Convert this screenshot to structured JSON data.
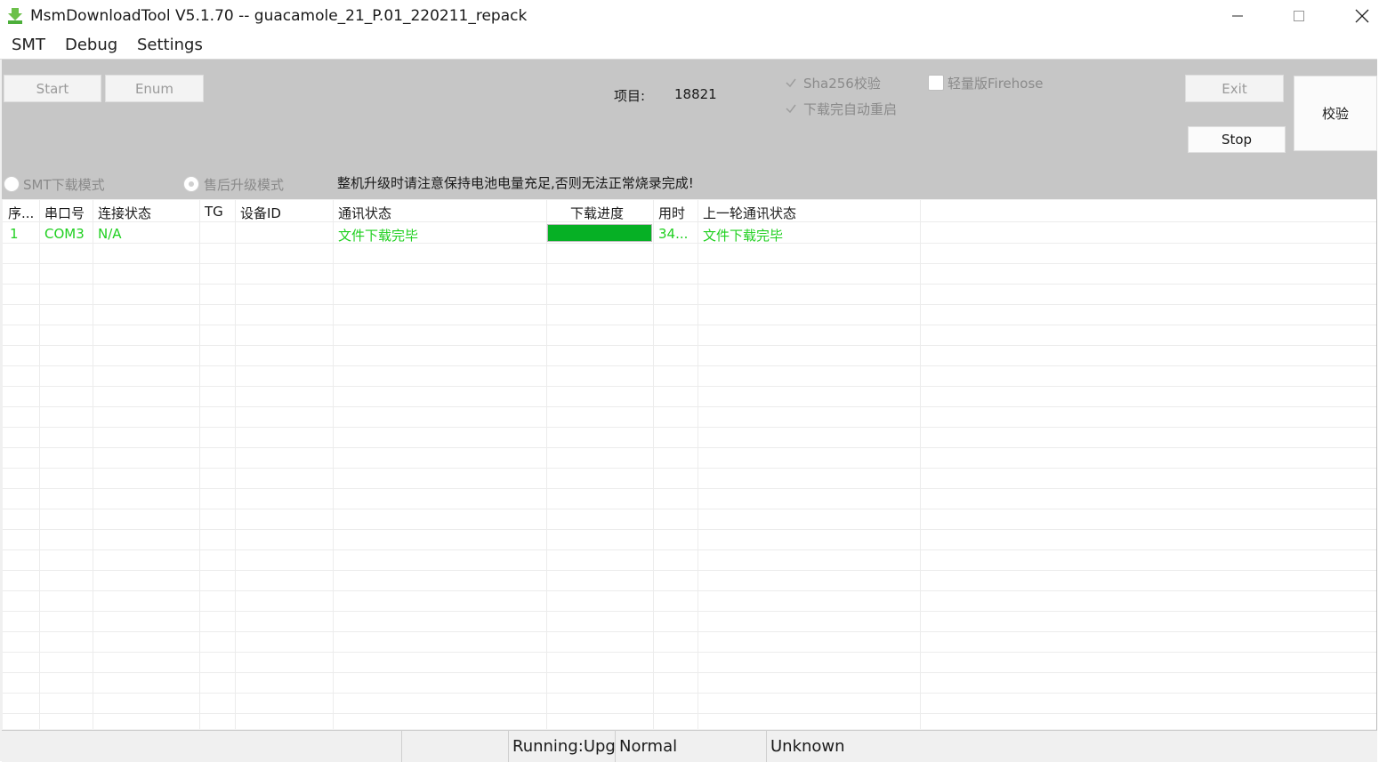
{
  "window": {
    "title": "MsmDownloadTool V5.1.70 -- guacamole_21_P.01_220211_repack"
  },
  "menu": [
    "SMT",
    "Debug",
    "Settings"
  ],
  "toolbar": {
    "start_label": "Start",
    "enum_label": "Enum",
    "project_label": "项目:",
    "project_value": "18821",
    "sha256_label": "Sha256校验",
    "sha256_checked": true,
    "autoreboot_label": "下载完自动重启",
    "autoreboot_checked": true,
    "lite_firehose_label": "轻量版Firehose",
    "lite_firehose_checked": false,
    "exit_label": "Exit",
    "stop_label": "Stop",
    "verify_label": "校验",
    "smt_mode_label": "SMT下载模式",
    "aftersale_mode_label": "售后升级模式",
    "warning": "整机升级时请注意保持电池电量充足,否则无法正常烧录完成!"
  },
  "table": {
    "headers": [
      "序...",
      "串口号",
      "连接状态",
      "TG",
      "设备ID",
      "通讯状态",
      "下载进度",
      "用时",
      "上一轮通讯状态"
    ],
    "rows": [
      {
        "index": "1",
        "port": "COM3",
        "connection": "N/A",
        "tg": "",
        "device_id": "",
        "comm_status": "文件下载完毕",
        "progress": 1.0,
        "time": "34...",
        "last_status": "文件下载完毕"
      }
    ]
  },
  "statusbar": {
    "mode": "Running:Upg",
    "type": "Normal",
    "state": "Unknown"
  },
  "colors": {
    "panel_bg": "#c6c6c6",
    "ok_text": "#20d020",
    "progress_fill": "#06b025"
  }
}
